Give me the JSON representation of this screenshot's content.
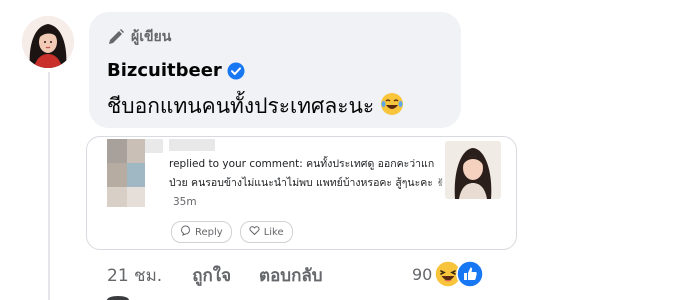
{
  "comment": {
    "author_badge": "ผู้เขียน",
    "author_name": "Bizcuitbeer",
    "text": "ชีบอกแทนคนทั้งประเทศละนะ",
    "text_emoji": "laughing-tears-emoji"
  },
  "screenshot": {
    "notification_text": "replied to your comment: คนทั้งประเทศดู ออกคะว่าแกป่วย คนรอบข้างไม่แนะนำไม่พบ แพทย์บ้างหรอคะ สู้ๆนะคะ ✌",
    "time": "35m",
    "reply_label": "Reply",
    "like_label": "Like"
  },
  "actions": {
    "time": "21 ชม.",
    "like": "ถูกใจ",
    "reply": "ตอบกลับ",
    "reaction_count": "90",
    "reaction_icons": [
      "haha-reaction-icon",
      "like-reaction-icon"
    ]
  },
  "colors": {
    "bubble_bg": "#f0f2f5",
    "verified_blue": "#1877f2",
    "secondary_text": "#65676b"
  }
}
